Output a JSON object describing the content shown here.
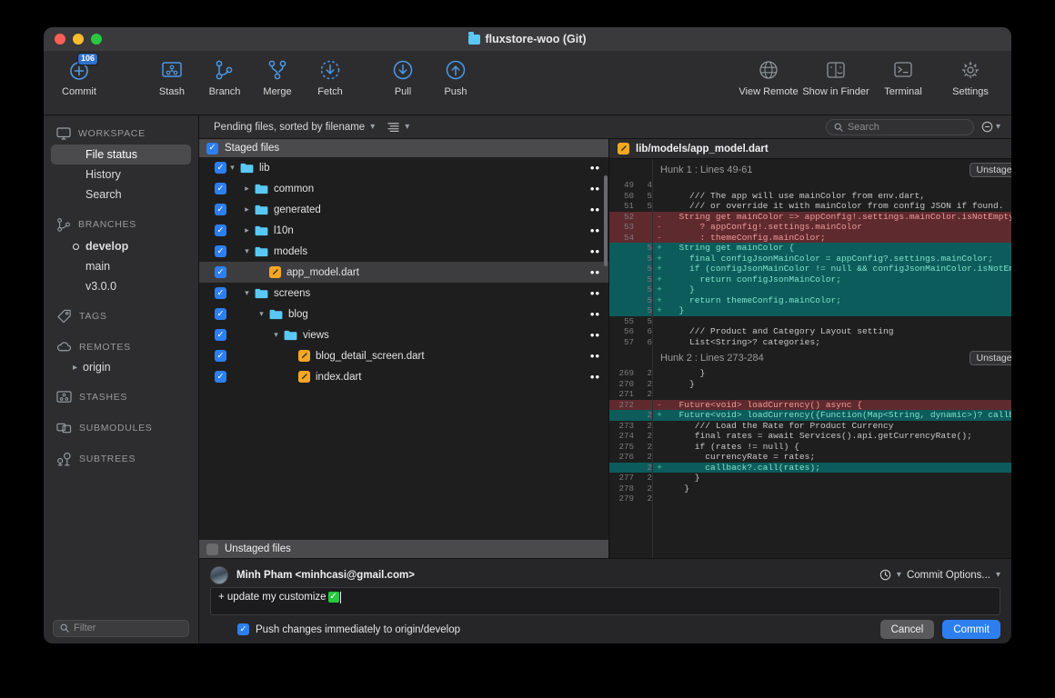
{
  "window": {
    "title": "fluxstore-woo (Git)",
    "title_icon": "folder-icon"
  },
  "toolbar": {
    "left": [
      {
        "label": "Commit",
        "icon": "commit-icon",
        "badge": "106"
      }
    ],
    "middle": [
      {
        "label": "Stash",
        "icon": "stash-icon"
      },
      {
        "label": "Branch",
        "icon": "branch-icon"
      },
      {
        "label": "Merge",
        "icon": "merge-icon"
      },
      {
        "label": "Fetch",
        "icon": "fetch-icon"
      }
    ],
    "pullpush": [
      {
        "label": "Pull",
        "icon": "pull-icon"
      },
      {
        "label": "Push",
        "icon": "push-icon"
      }
    ],
    "right": [
      {
        "label": "View Remote",
        "icon": "globe-icon"
      },
      {
        "label": "Show in Finder",
        "icon": "finder-icon"
      },
      {
        "label": "Terminal",
        "icon": "terminal-icon"
      },
      {
        "label": "Settings",
        "icon": "gear-icon"
      }
    ]
  },
  "sidebar": {
    "sections": [
      {
        "title": "WORKSPACE",
        "icon": "monitor-icon"
      },
      {
        "title": "BRANCHES",
        "icon": "branch-icon"
      },
      {
        "title": "TAGS",
        "icon": "tag-icon"
      },
      {
        "title": "REMOTES",
        "icon": "cloud-icon"
      },
      {
        "title": "STASHES",
        "icon": "stash-icon"
      },
      {
        "title": "SUBMODULES",
        "icon": "submodule-icon"
      },
      {
        "title": "SUBTREES",
        "icon": "subtree-icon"
      }
    ],
    "workspace_items": [
      {
        "label": "File status",
        "selected": true
      },
      {
        "label": "History",
        "selected": false
      },
      {
        "label": "Search",
        "selected": false
      }
    ],
    "branches": [
      {
        "label": "develop",
        "current": true
      },
      {
        "label": "main",
        "current": false
      },
      {
        "label": "v3.0.0",
        "current": false
      }
    ],
    "remotes": [
      {
        "label": "origin"
      }
    ],
    "filter_placeholder": "Filter"
  },
  "filesbar": {
    "sort_label": "Pending files, sorted by filename",
    "search_placeholder": "Search"
  },
  "filepane": {
    "staged_header": "Staged files",
    "unstaged_header": "Unstaged files",
    "rows": [
      {
        "name": "lib",
        "type": "folder",
        "indent": 0,
        "disclosure": "down",
        "checked": true,
        "selected": false
      },
      {
        "name": "common",
        "type": "folder",
        "indent": 1,
        "disclosure": "right",
        "checked": true,
        "selected": false
      },
      {
        "name": "generated",
        "type": "folder",
        "indent": 1,
        "disclosure": "right",
        "checked": true,
        "selected": false
      },
      {
        "name": "l10n",
        "type": "folder",
        "indent": 1,
        "disclosure": "right",
        "checked": true,
        "selected": false
      },
      {
        "name": "models",
        "type": "folder",
        "indent": 1,
        "disclosure": "down",
        "checked": true,
        "selected": false
      },
      {
        "name": "app_model.dart",
        "type": "file",
        "indent": 2,
        "disclosure": "none",
        "checked": true,
        "selected": true
      },
      {
        "name": "screens",
        "type": "folder",
        "indent": 1,
        "disclosure": "down",
        "checked": true,
        "selected": false
      },
      {
        "name": "blog",
        "type": "folder",
        "indent": 2,
        "disclosure": "down",
        "checked": true,
        "selected": false
      },
      {
        "name": "views",
        "type": "folder",
        "indent": 3,
        "disclosure": "down",
        "checked": true,
        "selected": false
      },
      {
        "name": "blog_detail_screen.dart",
        "type": "file",
        "indent": 4,
        "disclosure": "none",
        "checked": true,
        "selected": false
      },
      {
        "name": "index.dart",
        "type": "file",
        "indent": 4,
        "disclosure": "none",
        "checked": true,
        "selected": false
      }
    ],
    "row_menu_glyph": "••"
  },
  "diff": {
    "file_path": "lib/models/app_model.dart",
    "more_glyph": "•••",
    "hunks": [
      {
        "title": "Hunk 1 : Lines 49-61",
        "action": "Unstage hunk",
        "lines": [
          {
            "old": "49",
            "new": "4",
            "sign": "",
            "kind": "ctx",
            "code": ""
          },
          {
            "old": "50",
            "new": "5",
            "sign": "",
            "kind": "ctx",
            "code": "    /// The app will use mainColor from env.dart,"
          },
          {
            "old": "51",
            "new": "5",
            "sign": "",
            "kind": "ctx",
            "code": "    /// or override it with mainColor from config JSON if found."
          },
          {
            "old": "52",
            "new": "",
            "sign": "-",
            "kind": "del",
            "code": "  String get mainColor => appConfig!.settings.mainColor.isNotEmpty"
          },
          {
            "old": "53",
            "new": "",
            "sign": "-",
            "kind": "del",
            "code": "      ? appConfig!.settings.mainColor"
          },
          {
            "old": "54",
            "new": "",
            "sign": "-",
            "kind": "del",
            "code": "      : themeConfig.mainColor;"
          },
          {
            "old": "",
            "new": "5",
            "sign": "+",
            "kind": "add",
            "code": "  String get mainColor {"
          },
          {
            "old": "",
            "new": "5",
            "sign": "+",
            "kind": "add",
            "code": "    final configJsonMainColor = appConfig?.settings.mainColor;"
          },
          {
            "old": "",
            "new": "5",
            "sign": "+",
            "kind": "add",
            "code": "    if (configJsonMainColor != null && configJsonMainColor.isNotEmpty) {"
          },
          {
            "old": "",
            "new": "5",
            "sign": "+",
            "kind": "add",
            "code": "      return configJsonMainColor;"
          },
          {
            "old": "",
            "new": "5",
            "sign": "+",
            "kind": "add",
            "code": "    }"
          },
          {
            "old": "",
            "new": "5",
            "sign": "+",
            "kind": "add",
            "code": "    return themeConfig.mainColor;"
          },
          {
            "old": "",
            "new": "5",
            "sign": "+",
            "kind": "add",
            "code": "  }"
          },
          {
            "old": "55",
            "new": "5",
            "sign": "",
            "kind": "ctx",
            "code": ""
          },
          {
            "old": "56",
            "new": "6",
            "sign": "",
            "kind": "ctx",
            "code": "    /// Product and Category Layout setting"
          },
          {
            "old": "57",
            "new": "6",
            "sign": "",
            "kind": "ctx",
            "code": "    List<String>? categories;"
          }
        ]
      },
      {
        "title": "Hunk 2 : Lines 273-284",
        "action": "Unstage hunk",
        "lines": [
          {
            "old": "269",
            "new": "2",
            "sign": "",
            "kind": "ctx",
            "code": "      }"
          },
          {
            "old": "270",
            "new": "2",
            "sign": "",
            "kind": "ctx",
            "code": "    }"
          },
          {
            "old": "271",
            "new": "2",
            "sign": "",
            "kind": "ctx",
            "code": ""
          },
          {
            "old": "272",
            "new": "",
            "sign": "-",
            "kind": "del",
            "code": "  Future<void> loadCurrency() async {"
          },
          {
            "old": "",
            "new": "2",
            "sign": "+",
            "kind": "add",
            "code": "  Future<void> loadCurrency({Function(Map<String, dynamic>)? callback}) a"
          },
          {
            "old": "273",
            "new": "2",
            "sign": "",
            "kind": "ctx",
            "code": "     /// Load the Rate for Product Currency"
          },
          {
            "old": "274",
            "new": "2",
            "sign": "",
            "kind": "ctx",
            "code": "     final rates = await Services().api.getCurrencyRate();"
          },
          {
            "old": "275",
            "new": "2",
            "sign": "",
            "kind": "ctx",
            "code": "     if (rates != null) {"
          },
          {
            "old": "276",
            "new": "2",
            "sign": "",
            "kind": "ctx",
            "code": "       currencyRate = rates;"
          },
          {
            "old": "",
            "new": "2",
            "sign": "+",
            "kind": "add",
            "code": "       callback?.call(rates);"
          },
          {
            "old": "277",
            "new": "2",
            "sign": "",
            "kind": "ctx",
            "code": "     }"
          },
          {
            "old": "278",
            "new": "2",
            "sign": "",
            "kind": "ctx",
            "code": "   }"
          },
          {
            "old": "279",
            "new": "2",
            "sign": "",
            "kind": "ctx",
            "code": ""
          }
        ]
      }
    ]
  },
  "commit": {
    "author": "Minh Pham <minhcasi@gmail.com>",
    "history_icon": "clock-icon",
    "options_label": "Commit Options...",
    "message": "+ update my customize",
    "message_emoji": "✓",
    "push_label": "Push changes immediately to origin/develop",
    "push_checked": true,
    "cancel_label": "Cancel",
    "commit_label": "Commit"
  },
  "colors": {
    "accent": "#2d7ff0",
    "added": "#0d5c5c",
    "deleted": "#5f2a2e",
    "folder": "#5ac8f5",
    "modified": "#f5a623"
  }
}
